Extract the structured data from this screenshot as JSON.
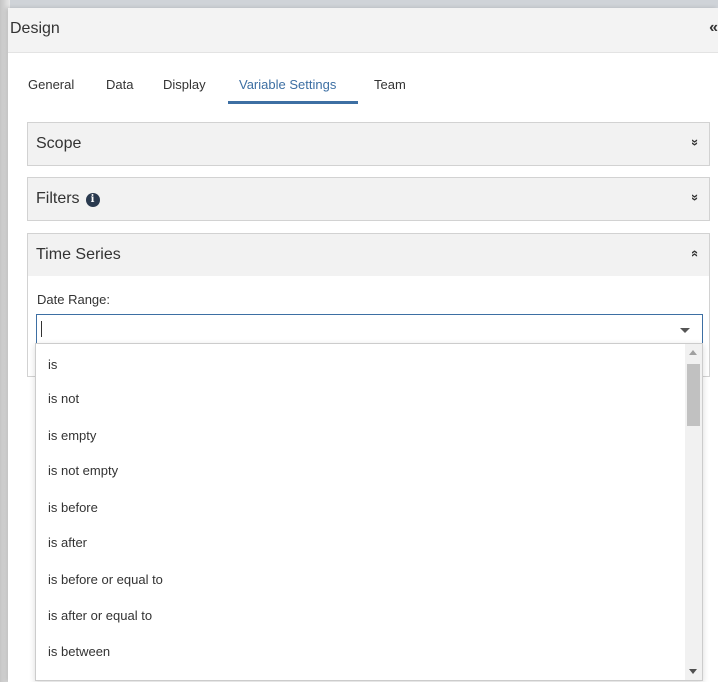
{
  "panel": {
    "title": "Design",
    "collapse_icon": "«"
  },
  "tabs": [
    {
      "label": "General"
    },
    {
      "label": "Data"
    },
    {
      "label": "Display"
    },
    {
      "label": "Variable Settings",
      "active": true
    },
    {
      "label": "Team"
    }
  ],
  "sections": {
    "scope": {
      "title": "Scope",
      "icon": "chevrons-down-icon",
      "glyph": "»"
    },
    "filters": {
      "title": "Filters",
      "info_glyph": "i",
      "glyph": "»"
    },
    "time_series": {
      "title": "Time Series",
      "glyph": "«",
      "date_range_label": "Date Range:",
      "date_range_value": ""
    }
  },
  "dropdown": {
    "options": [
      "is",
      "is not",
      "is empty",
      "is not empty",
      "is before",
      "is after",
      "is before or equal to",
      "is after or equal to",
      "is between"
    ]
  },
  "colors": {
    "accent": "#3d6fa3",
    "header_bg": "#f3f3f3",
    "section_bg": "#f2f2f2"
  }
}
